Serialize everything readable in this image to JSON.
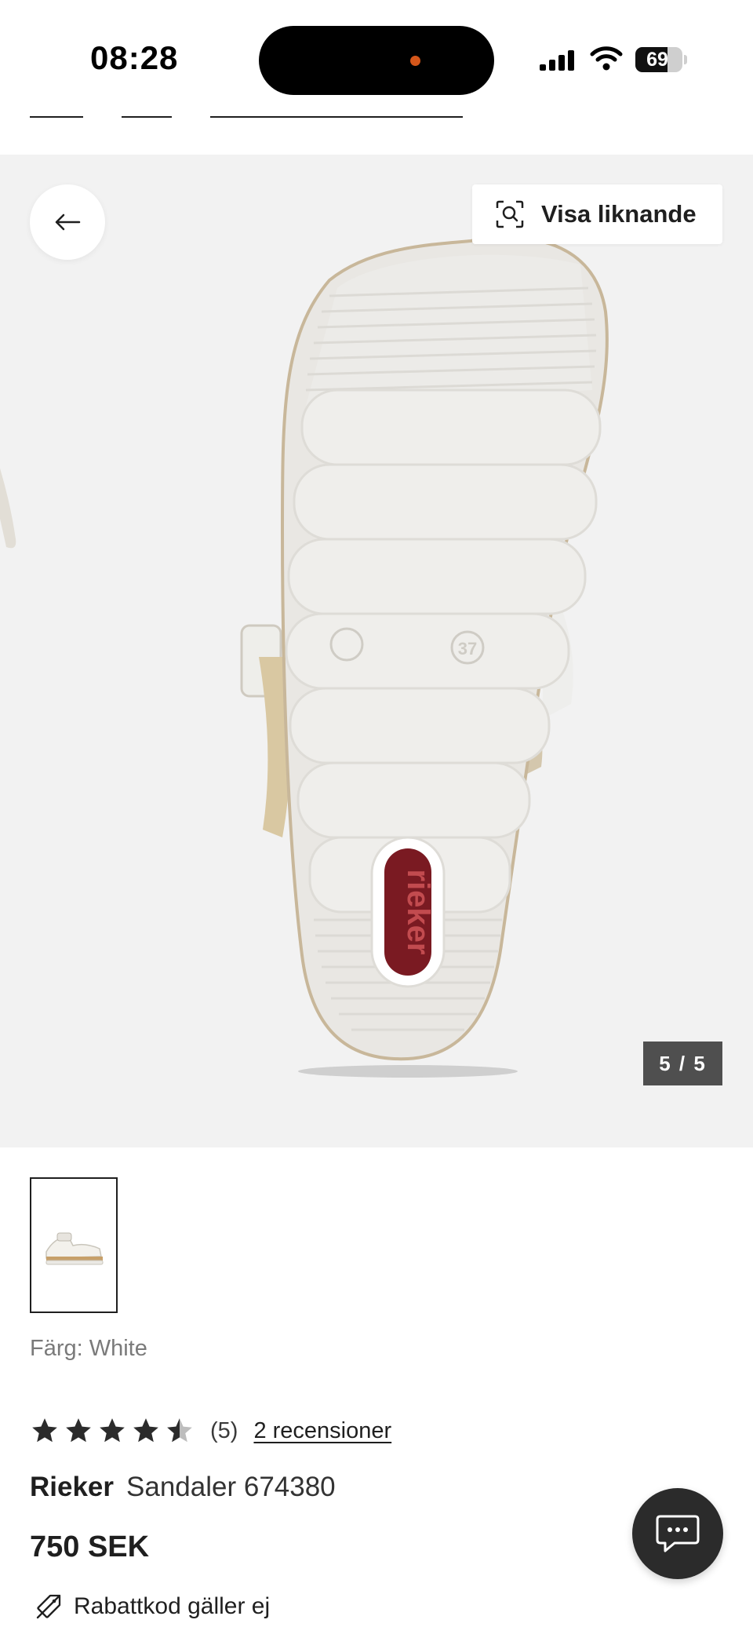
{
  "status_bar": {
    "time": "08:28",
    "battery_level": "69",
    "battery_fraction": 0.69,
    "icons": [
      "signal-icon",
      "wifi-icon",
      "battery-icon"
    ]
  },
  "gallery": {
    "back_icon": "arrow-left-icon",
    "similar_label": "Visa liknande",
    "similar_icon": "visual-search-icon",
    "counter": "5 / 5",
    "sole_logo_text": "rieker",
    "sole_size_mark": "37",
    "background_color": "#f2f2f2"
  },
  "product": {
    "color_line": "Färg: White",
    "rating_value": 4.5,
    "rating_count": "(5)",
    "reviews_link": "2 recensioner",
    "brand": "Rieker",
    "model": "Sandaler 674380",
    "price": "750 SEK",
    "discount_note": "Rabattkod gäller ej",
    "discount_icon": "no-tag-icon"
  },
  "chat": {
    "icon": "chat-bubble-icon"
  },
  "colors": {
    "text": "#1f1f1f",
    "counter_bg": "#4f4f4f",
    "chat_bg": "#2b2b2b",
    "logo_red": "#7a1a22"
  }
}
